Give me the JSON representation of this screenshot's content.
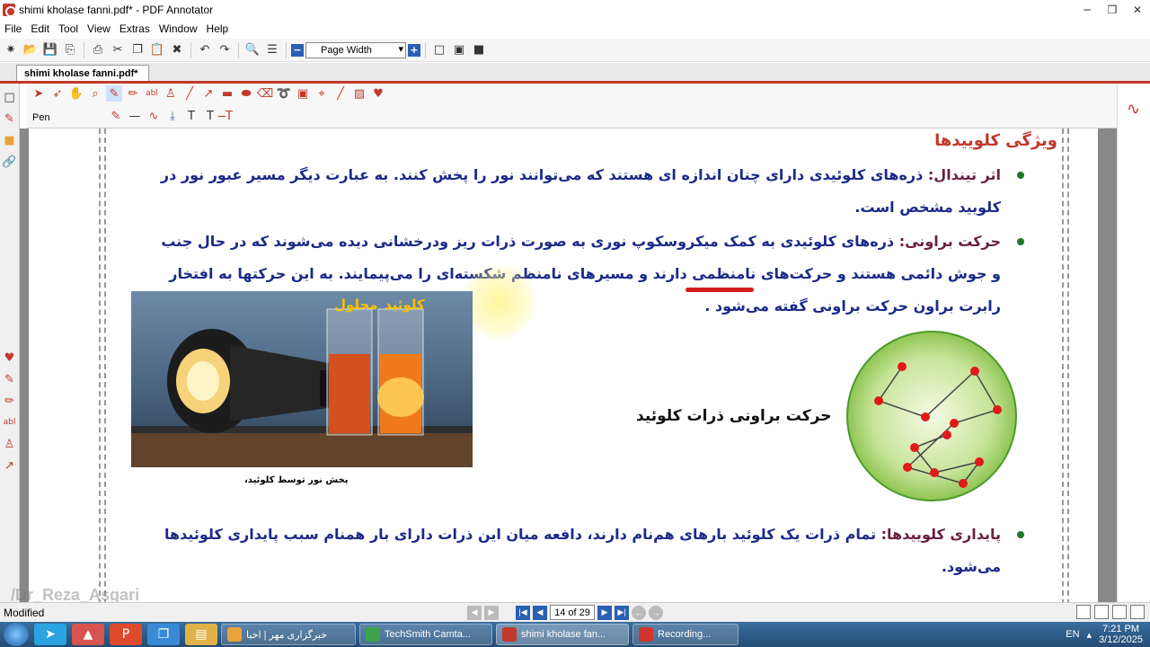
{
  "window": {
    "title": "shimi kholase fanni.pdf* - PDF Annotator",
    "controls": [
      "minimize",
      "restore",
      "close"
    ]
  },
  "menu": [
    "File",
    "Edit",
    "Tool",
    "View",
    "Extras",
    "Window",
    "Help"
  ],
  "toolbar": {
    "zoom_value": "Page Width"
  },
  "tab": {
    "label": "shimi kholase fanni.pdf*"
  },
  "annotation_toolbar": {
    "tool_label": "Pen"
  },
  "document": {
    "section_title": "ویژگی کلوییدها",
    "tyndall": {
      "term": "اثر تیندال:",
      "line1": "ذره‌های کلوئیدی دارای چنان اندازه ای هستند که می‌توانند نور را پخش کنند. به عبارت دیگر مسیر عبور نور در",
      "line2": "کلویید مشخص است."
    },
    "brownian": {
      "term": "حرکت براونی:",
      "line1": "ذره‌های کلوئیدی به کمک میکروسکوپ نوری به صورت ذرات ریز ودرخشانی دیده می‌شوند که در حال جنب",
      "line2": "و جوش دائمی هستند و حرکت‌های نامنظمی دارند و مسیرهای نامنظم شکسته‌ای را می‌پیمایند. به این حرکتها به افتخار",
      "line3": "رابرت براون حرکت براونی گفته می‌شود ."
    },
    "photo": {
      "label_colloid": "کلوئید",
      "label_solution": "محلول",
      "caption": "پخش نور توسط کلوئید،"
    },
    "diagram_label": "حرکت براونی ذرات کلوئید",
    "stability": {
      "term": "پایداری کلوییدها:",
      "line1": "تمام ذرات یک کلوئید بارهای هم‌نام دارند، دافعه میان این ذرات دارای بار همنام سبب پایداری کلوئیدها",
      "line2": "می‌شود."
    },
    "colors": {
      "title": "#c0392b",
      "body": "#1b2a8a",
      "term": "#6b1e40",
      "bullet": "#1b7a2b"
    }
  },
  "status": {
    "text": "Modified",
    "page_input": "14 of 29"
  },
  "watermark": "/Dr_Reza_Asgari",
  "taskbar": {
    "items": [
      {
        "label": "خبرگزاری مهر | اخبا",
        "color": "#e8a33d"
      },
      {
        "label": "TechSmith Camta...",
        "color": "#3ca34a"
      },
      {
        "label": "shimi kholase fan...",
        "color": "#c0392b"
      },
      {
        "label": "Recording...",
        "color": "#d0362e"
      }
    ],
    "language": "EN",
    "time": "7:21 PM",
    "date": "3/12/2025"
  }
}
